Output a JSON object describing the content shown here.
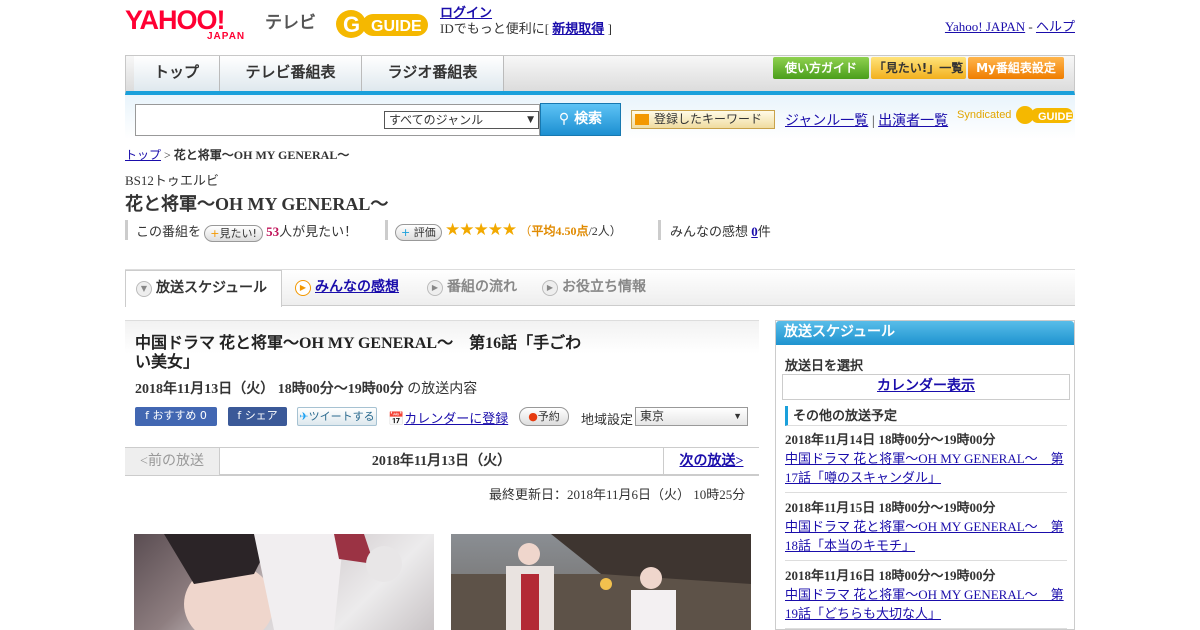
{
  "header": {
    "logo_yahoo": "YAHOO!",
    "logo_japan": "JAPAN",
    "logo_tv": "テレビ",
    "logo_gguide": "GUIDE",
    "login_label": "ログイン",
    "login_desc": "IDでもっと便利に[",
    "register_label": "新規取得",
    "login_desc_end": "]",
    "yahoo_japan_link": "Yahoo! JAPAN",
    "link_sep": "-",
    "help_link": "ヘルプ"
  },
  "nav": {
    "tabs": [
      "トップ",
      "テレビ番組表",
      "ラジオ番組表"
    ],
    "buttons": [
      "使い方ガイド",
      "「見たい!」一覧",
      "My番組表設定"
    ]
  },
  "search": {
    "placeholder": "",
    "genre_selected": "すべてのジャンル",
    "search_label": "検索",
    "keyword_button": "登録したキーワード",
    "genre_list": "ジャンル一覧",
    "link_sep": "|",
    "cast_list": "出演者一覧",
    "syndicated": "Syndicated"
  },
  "breadcrumb": {
    "top": "トップ",
    "sep": ">",
    "current": "花と将軍～OH MY GENERAL～"
  },
  "program": {
    "channel": "BS12トゥエルビ",
    "title": "花と将軍～OH MY GENERAL～",
    "want_prefix": "この番組を",
    "want_button": "見たい!",
    "want_count": "53",
    "want_suffix": "人が見たい！",
    "rate_button": "評価",
    "stars": "★★★★★",
    "rating_open": "（",
    "rating_avg": "平均4.50点",
    "rating_count": "/2人）",
    "impression_prefix": "みんなの感想",
    "impression_count": "0",
    "impression_suffix": "件"
  },
  "sub_tabs": {
    "schedule": "放送スケジュール",
    "impressions": "みんなの感想",
    "flow": "番組の流れ",
    "info": "お役立ち情報"
  },
  "episode": {
    "title": "中国ドラマ 花と将軍～OH MY GENERAL～　第16話「手ごわい美女」",
    "airtime": "2018年11月13日（火）  18時00分～19時00分",
    "airtime_suffix": "の放送内容",
    "fb_recommend": "おすすめ 0",
    "fb_share": "シェア",
    "tweet": "ツイートする",
    "calendar": "カレンダーに登録",
    "reserve": "予約",
    "region_label": "地域設定",
    "region_value": "東京"
  },
  "pager": {
    "prev": "<前の放送",
    "date": "2018年11月13日（火）",
    "next": "次の放送>"
  },
  "updated": "最終更新日：2018年11月6日（火）  10時25分",
  "side": {
    "title": "放送スケジュール",
    "date_label": "放送日を選択",
    "calendar_button": "カレンダー表示",
    "other_heading": "その他の放送予定",
    "schedule": [
      {
        "time": "2018年11月14日  18時00分～19時00分",
        "title": "中国ドラマ 花と将軍～OH MY GENERAL～　第17話「噂のスキャンダル」"
      },
      {
        "time": "2018年11月15日  18時00分～19時00分",
        "title": "中国ドラマ 花と将軍～OH MY GENERAL～　第18話「本当のキモチ」"
      },
      {
        "time": "2018年11月16日  18時00分～19時00分",
        "title": "中国ドラマ 花と将軍～OH MY GENERAL～　第19話「どちらも大切な人」"
      }
    ]
  },
  "colors": {
    "accent_blue": "#1aa0db",
    "brand_red": "#ff0033",
    "star": "#f2a900",
    "rating_text": "#e08a00"
  }
}
